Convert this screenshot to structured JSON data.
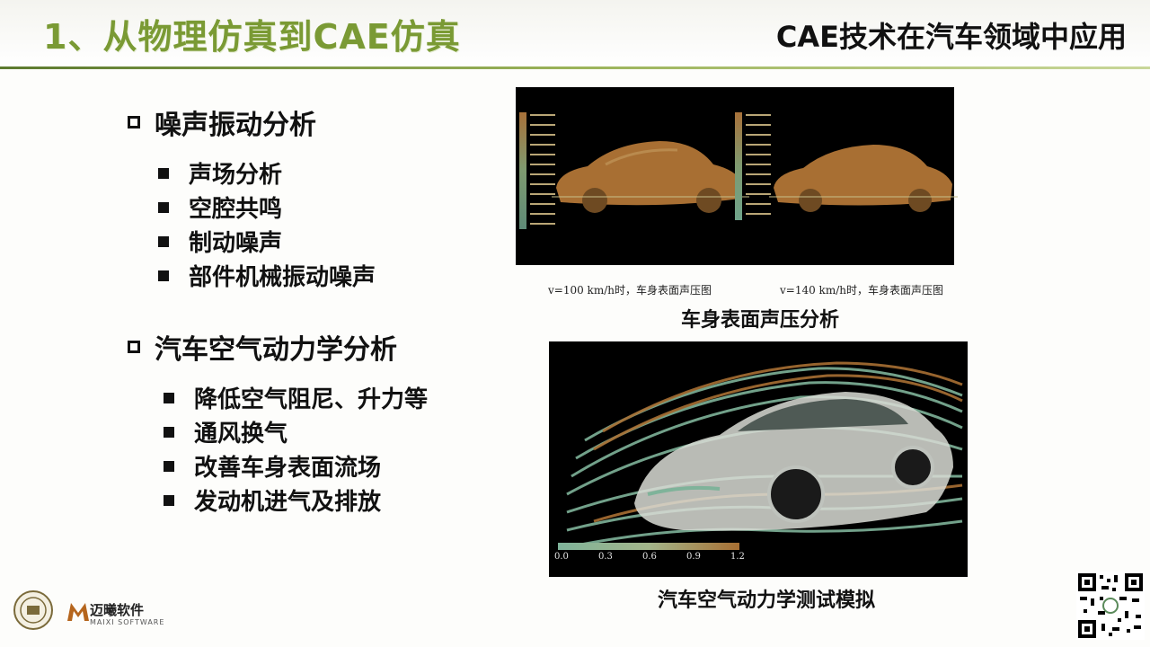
{
  "header": {
    "title_left": "1、从物理仿真到CAE仿真",
    "title_right": "CAE技术在汽车领域中应用"
  },
  "section1": {
    "heading": "噪声振动分析",
    "items": [
      "声场分析",
      "空腔共鸣",
      "制动噪声",
      "部件机械振动噪声"
    ]
  },
  "section2": {
    "heading": "汽车空气动力学分析",
    "items": [
      "降低空气阻尼、升力等",
      "通风换气",
      "改善车身表面流场",
      "发动机进气及排放"
    ]
  },
  "figure1": {
    "sub_caption_left": "v=100 km/h时，车身表面声压图",
    "sub_caption_right": "v=140 km/h时，车身表面声压图",
    "caption": "车身表面声压分析"
  },
  "figure2": {
    "colorbar_ticks": [
      "0.0",
      "0.3",
      "0.6",
      "0.9",
      "1.2"
    ],
    "caption": "汽车空气动力学测试模拟"
  },
  "footer": {
    "brand_name": "迈曦软件",
    "brand_sub": "MAIXI SOFTWARE"
  },
  "colors": {
    "title_green": "#7a9a34",
    "car_bronze": "#a86f33",
    "flow_teal": "#7fb39a"
  }
}
